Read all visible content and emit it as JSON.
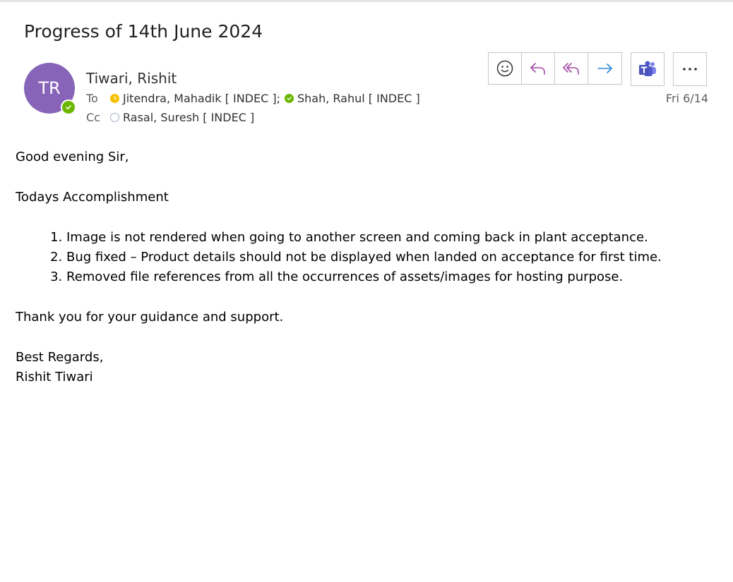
{
  "email": {
    "subject": "Progress of 14th June 2024",
    "sender": {
      "initials": "TR",
      "name": "Tiwari, Rishit",
      "avatar_color": "#8764b8",
      "presence": "available"
    },
    "to_label": "To",
    "cc_label": "Cc",
    "to": [
      {
        "name": "Jitendra, Mahadik [ INDEC ];",
        "status": "away"
      },
      {
        "name": "Shah, Rahul [ INDEC ]",
        "status": "available"
      }
    ],
    "cc": [
      {
        "name": "Rasal, Suresh [ INDEC ]",
        "status": "offline"
      }
    ],
    "date": "Fri 6/14"
  },
  "toolbar": {
    "buttons": [
      "smiley-icon",
      "reply-icon",
      "reply-all-icon",
      "forward-icon",
      "teams-icon",
      "more-icon"
    ]
  },
  "body": {
    "greeting": "Good evening Sir,",
    "heading": "Todays Accomplishment",
    "items": [
      "Image is not rendered when going to another screen and coming back in plant acceptance.",
      "Bug fixed – Product details should not be displayed when landed on acceptance for first time.",
      "Removed file references from all the occurrences of assets/images for hosting purpose."
    ],
    "thanks": "Thank you for your guidance and support.",
    "closing": "Best Regards,",
    "signature": "Rishit Tiwari"
  },
  "colors": {
    "accent_purple": "#8764b8",
    "reply_purple": "#a349a4",
    "forward_blue": "#2b88d8",
    "available_green": "#6bb700",
    "away_yellow": "#f7c000"
  }
}
